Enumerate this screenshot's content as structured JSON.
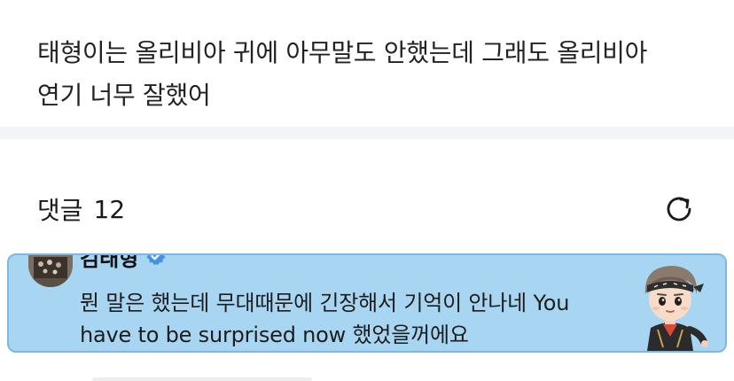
{
  "post": {
    "text_line1": "태형이는 올리비아 귀에 아무말도 안했는데 그래도 올리비아",
    "text_line2": "연기 너무 잘했어"
  },
  "comments": {
    "label": "댓글",
    "count": "12",
    "refresh_icon": "refresh-icon"
  },
  "comment": {
    "author": "김태형",
    "verified_icon": "verified-badge-icon",
    "body_line1": "뭔 말은 했는데 무대때문에 긴장해서 기억이 안나네 You",
    "body_line2": "have to be surprised now 했었을꺼에요",
    "sticker_icon": "character-sticker",
    "highlight_color": "#a8d6f2"
  }
}
